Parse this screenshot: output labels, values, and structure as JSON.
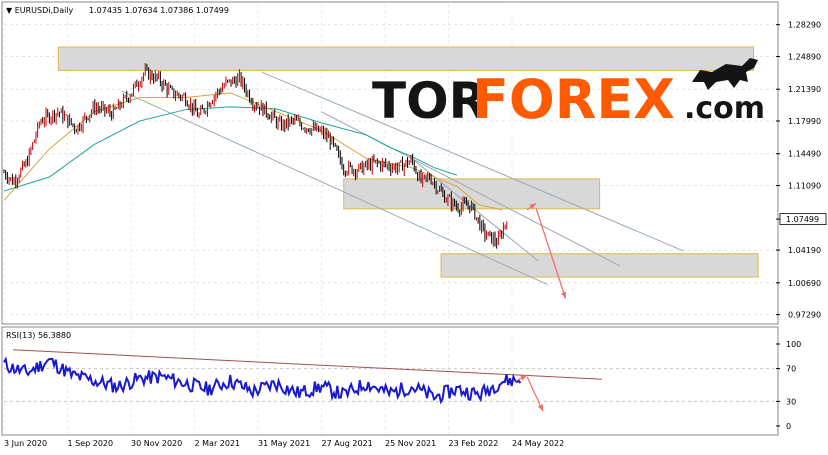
{
  "chart_data": [
    {
      "type": "candlestick",
      "symbol": "EURUSDi,Daily",
      "ohlc_header": "1.07435 1.07634 1.07386 1.07499",
      "last_price_label": "1.07499",
      "last_price": 1.07499,
      "ylim": [
        0.965,
        1.305
      ],
      "y_ticks": [
        "1.28290",
        "1.24890",
        "1.21390",
        "1.17990",
        "1.14490",
        "1.11090",
        "1.07499",
        "1.04190",
        "1.00690",
        "0.97290"
      ],
      "x_ticks": [
        "3 Jun 2020",
        "1 Sep 2020",
        "30 Nov 2020",
        "2 Mar 2021",
        "31 May 2021",
        "27 Aug 2021",
        "25 Nov 2021",
        "23 Feb 2022",
        "24 May 2022"
      ],
      "price_path": [
        [
          0,
          1.125
        ],
        [
          0.02,
          1.115
        ],
        [
          0.05,
          1.135
        ],
        [
          0.08,
          1.18
        ],
        [
          0.12,
          1.19
        ],
        [
          0.16,
          1.172
        ],
        [
          0.2,
          1.195
        ],
        [
          0.24,
          1.188
        ],
        [
          0.28,
          1.21
        ],
        [
          0.31,
          1.232
        ],
        [
          0.34,
          1.225
        ],
        [
          0.37,
          1.21
        ],
        [
          0.4,
          1.205
        ],
        [
          0.43,
          1.185
        ],
        [
          0.46,
          1.205
        ],
        [
          0.49,
          1.22
        ],
        [
          0.52,
          1.225
        ],
        [
          0.55,
          1.2
        ],
        [
          0.58,
          1.19
        ],
        [
          0.61,
          1.175
        ],
        [
          0.64,
          1.18
        ],
        [
          0.66,
          1.175
        ],
        [
          0.7,
          1.168
        ],
        [
          0.72,
          1.16
        ],
        [
          0.75,
          1.13
        ],
        [
          0.78,
          1.128
        ],
        [
          0.82,
          1.135
        ],
        [
          0.85,
          1.132
        ],
        [
          0.87,
          1.13
        ],
        [
          0.9,
          1.138
        ],
        [
          0.92,
          1.115
        ],
        [
          0.94,
          1.12
        ],
        [
          0.97,
          1.1
        ],
        [
          1.0,
          1.088
        ],
        [
          1.03,
          1.09
        ],
        [
          1.06,
          1.06
        ],
        [
          1.09,
          1.05
        ],
        [
          1.11,
          1.075
        ]
      ],
      "sma_slow_path": [
        [
          0,
          1.105
        ],
        [
          0.1,
          1.12
        ],
        [
          0.2,
          1.155
        ],
        [
          0.3,
          1.18
        ],
        [
          0.4,
          1.192
        ],
        [
          0.5,
          1.195
        ],
        [
          0.6,
          1.193
        ],
        [
          0.7,
          1.178
        ],
        [
          0.8,
          1.165
        ],
        [
          0.85,
          1.152
        ],
        [
          0.9,
          1.142
        ],
        [
          0.95,
          1.13
        ],
        [
          1.0,
          1.122
        ]
      ],
      "sma_fast_path": [
        [
          0,
          1.095
        ],
        [
          0.1,
          1.15
        ],
        [
          0.2,
          1.19
        ],
        [
          0.3,
          1.205
        ],
        [
          0.4,
          1.205
        ],
        [
          0.5,
          1.21
        ],
        [
          0.6,
          1.19
        ],
        [
          0.7,
          1.17
        ],
        [
          0.8,
          1.14
        ],
        [
          0.9,
          1.13
        ],
        [
          1.0,
          1.11
        ],
        [
          1.05,
          1.09
        ],
        [
          1.1,
          1.085
        ]
      ],
      "zones": [
        {
          "x0": 0.12,
          "x1": 1.655,
          "y0": 1.234,
          "y1": 1.259
        },
        {
          "x0": 0.75,
          "x1": 1.315,
          "y0": 1.086,
          "y1": 1.118
        },
        {
          "x0": 0.965,
          "x1": 1.665,
          "y0": 1.013,
          "y1": 1.038
        }
      ],
      "trend_lines": [
        {
          "x0": 0.57,
          "y0": 1.232,
          "x1": 1.5,
          "y1": 1.041
        },
        {
          "x0": 0.7,
          "y0": 1.19,
          "x1": 1.36,
          "y1": 1.025
        },
        {
          "x0": 0.26,
          "y0": 1.212,
          "x1": 1.2,
          "y1": 1.005
        },
        {
          "x0": 0.9,
          "y0": 1.14,
          "x1": 1.18,
          "y1": 1.03
        }
      ],
      "forecast": [
        {
          "x0": 1.155,
          "y0": 1.085,
          "x1": 1.175,
          "y1": 1.092
        },
        {
          "x0": 1.175,
          "y0": 1.086,
          "x1": 1.24,
          "y1": 0.99
        }
      ],
      "colors": {
        "bull": "#c00000",
        "bear": "#000000",
        "sma_slow": "#1aa39a",
        "sma_fast": "#d9a23a",
        "zone": "#d8d8d8",
        "zone_border": "#e0b84a",
        "trend": "#9aa8b4",
        "forecast": "#f07070"
      }
    },
    {
      "type": "line",
      "title": "RSI(13) 56.3880",
      "ylim": [
        0,
        100
      ],
      "y_ticks": [
        "100",
        "70",
        "30",
        "0"
      ],
      "rsi_path": [
        [
          0,
          75
        ],
        [
          0.05,
          65
        ],
        [
          0.1,
          80
        ],
        [
          0.15,
          62
        ],
        [
          0.2,
          55
        ],
        [
          0.25,
          48
        ],
        [
          0.3,
          58
        ],
        [
          0.35,
          60
        ],
        [
          0.4,
          52
        ],
        [
          0.45,
          45
        ],
        [
          0.5,
          55
        ],
        [
          0.55,
          42
        ],
        [
          0.6,
          52
        ],
        [
          0.65,
          40
        ],
        [
          0.7,
          48
        ],
        [
          0.75,
          38
        ],
        [
          0.8,
          52
        ],
        [
          0.85,
          40
        ],
        [
          0.9,
          48
        ],
        [
          0.95,
          35
        ],
        [
          1.0,
          45
        ],
        [
          1.05,
          38
        ],
        [
          1.1,
          55
        ],
        [
          1.14,
          56
        ]
      ],
      "trend_line": {
        "x0": 0.02,
        "y0": 93,
        "x1": 1.32,
        "y1": 57
      },
      "forecast": [
        {
          "x0": 1.13,
          "y0": 55,
          "x1": 1.155,
          "y1": 62
        },
        {
          "x0": 1.155,
          "y0": 60,
          "x1": 1.19,
          "y1": 18
        }
      ],
      "colors": {
        "line": "#1a1acc",
        "trend": "#a05050",
        "forecast": "#f07070"
      }
    }
  ],
  "logo": {
    "tor": "TOR",
    "forex": "FOREX",
    "dotcom": ".com",
    "colors": {
      "tor": "#141414",
      "forex": "#ff5a00"
    }
  }
}
